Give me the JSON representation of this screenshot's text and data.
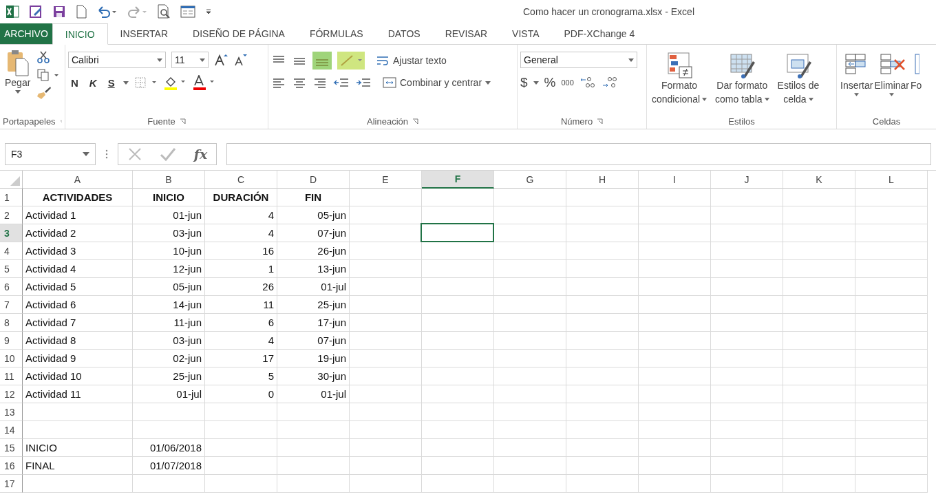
{
  "window": {
    "title": "Como hacer un cronograma.xlsx - Excel"
  },
  "tabs": [
    {
      "label": "ARCHIVO",
      "kind": "file",
      "selected": false
    },
    {
      "label": "INICIO",
      "kind": "tab",
      "selected": true
    },
    {
      "label": "INSERTAR",
      "kind": "tab",
      "selected": false
    },
    {
      "label": "DISEÑO DE PÁGINA",
      "kind": "tab",
      "selected": false
    },
    {
      "label": "FÓRMULAS",
      "kind": "tab",
      "selected": false
    },
    {
      "label": "DATOS",
      "kind": "tab",
      "selected": false
    },
    {
      "label": "REVISAR",
      "kind": "tab",
      "selected": false
    },
    {
      "label": "VISTA",
      "kind": "tab",
      "selected": false
    },
    {
      "label": "PDF-XChange 4",
      "kind": "tab",
      "selected": false
    }
  ],
  "ribbon": {
    "clipboard": {
      "paste": "Pegar",
      "label": "Portapapeles"
    },
    "font": {
      "family": "Calibri",
      "size": "11",
      "bold": "N",
      "italic": "K",
      "underline": "S",
      "label": "Fuente"
    },
    "alignment": {
      "wrap": "Ajustar texto",
      "merge": "Combinar y centrar",
      "label": "Alineación"
    },
    "number": {
      "format": "General",
      "currency": "$",
      "percent": "%",
      "thousands": "000",
      "label": "Número"
    },
    "styles": {
      "conditional": [
        "Formato",
        "condicional"
      ],
      "table": [
        "Dar formato",
        "como tabla"
      ],
      "cell": [
        "Estilos de",
        "celda"
      ],
      "label": "Estilos"
    },
    "cells": {
      "insert": "Insertar",
      "delete": "Eliminar",
      "format": "Fo",
      "label": "Celdas"
    }
  },
  "formula_bar": {
    "name_box": "F3",
    "fx": "fx"
  },
  "sheet": {
    "columns": [
      {
        "label": "A",
        "selected": false
      },
      {
        "label": "B",
        "selected": false
      },
      {
        "label": "C",
        "selected": false
      },
      {
        "label": "D",
        "selected": false
      },
      {
        "label": "E",
        "selected": false
      },
      {
        "label": "F",
        "selected": true
      },
      {
        "label": "G",
        "selected": false
      },
      {
        "label": "H",
        "selected": false
      },
      {
        "label": "I",
        "selected": false
      },
      {
        "label": "J",
        "selected": false
      },
      {
        "label": "K",
        "selected": false
      },
      {
        "label": "L",
        "selected": false
      }
    ],
    "rows": [
      {
        "number": "1",
        "selected": false,
        "kind": "header",
        "cells": [
          "ACTIVIDADES",
          "INICIO",
          "DURACIÓN",
          "FIN"
        ]
      },
      {
        "number": "2",
        "selected": false,
        "kind": "data",
        "cells": [
          "Actividad 1",
          "01-jun",
          "4",
          "05-jun"
        ]
      },
      {
        "number": "3",
        "selected": true,
        "kind": "data",
        "cells": [
          "Actividad 2",
          "03-jun",
          "4",
          "07-jun"
        ]
      },
      {
        "number": "4",
        "selected": false,
        "kind": "data",
        "cells": [
          "Actividad 3",
          "10-jun",
          "16",
          "26-jun"
        ]
      },
      {
        "number": "5",
        "selected": false,
        "kind": "data",
        "cells": [
          "Actividad 4",
          "12-jun",
          "1",
          "13-jun"
        ]
      },
      {
        "number": "6",
        "selected": false,
        "kind": "data",
        "cells": [
          "Actividad 5",
          "05-jun",
          "26",
          "01-jul"
        ]
      },
      {
        "number": "7",
        "selected": false,
        "kind": "data",
        "cells": [
          "Actividad 6",
          "14-jun",
          "11",
          "25-jun"
        ]
      },
      {
        "number": "8",
        "selected": false,
        "kind": "data",
        "cells": [
          "Actividad 7",
          "11-jun",
          "6",
          "17-jun"
        ]
      },
      {
        "number": "9",
        "selected": false,
        "kind": "data",
        "cells": [
          "Actividad 8",
          "03-jun",
          "4",
          "07-jun"
        ]
      },
      {
        "number": "10",
        "selected": false,
        "kind": "data",
        "cells": [
          "Actividad 9",
          "02-jun",
          "17",
          "19-jun"
        ]
      },
      {
        "number": "11",
        "selected": false,
        "kind": "data",
        "cells": [
          "Actividad 10",
          "25-jun",
          "5",
          "30-jun"
        ]
      },
      {
        "number": "12",
        "selected": false,
        "kind": "data",
        "cells": [
          "Actividad 11",
          "01-jul",
          "0",
          "01-jul"
        ]
      },
      {
        "number": "13",
        "selected": false,
        "kind": "data",
        "cells": []
      },
      {
        "number": "14",
        "selected": false,
        "kind": "data",
        "cells": []
      },
      {
        "number": "15",
        "selected": false,
        "kind": "data",
        "cells": [
          "INICIO",
          "01/06/2018"
        ]
      },
      {
        "number": "16",
        "selected": false,
        "kind": "data",
        "cells": [
          "FINAL",
          "01/07/2018"
        ]
      },
      {
        "number": "17",
        "selected": false,
        "kind": "data",
        "cells": []
      }
    ]
  }
}
